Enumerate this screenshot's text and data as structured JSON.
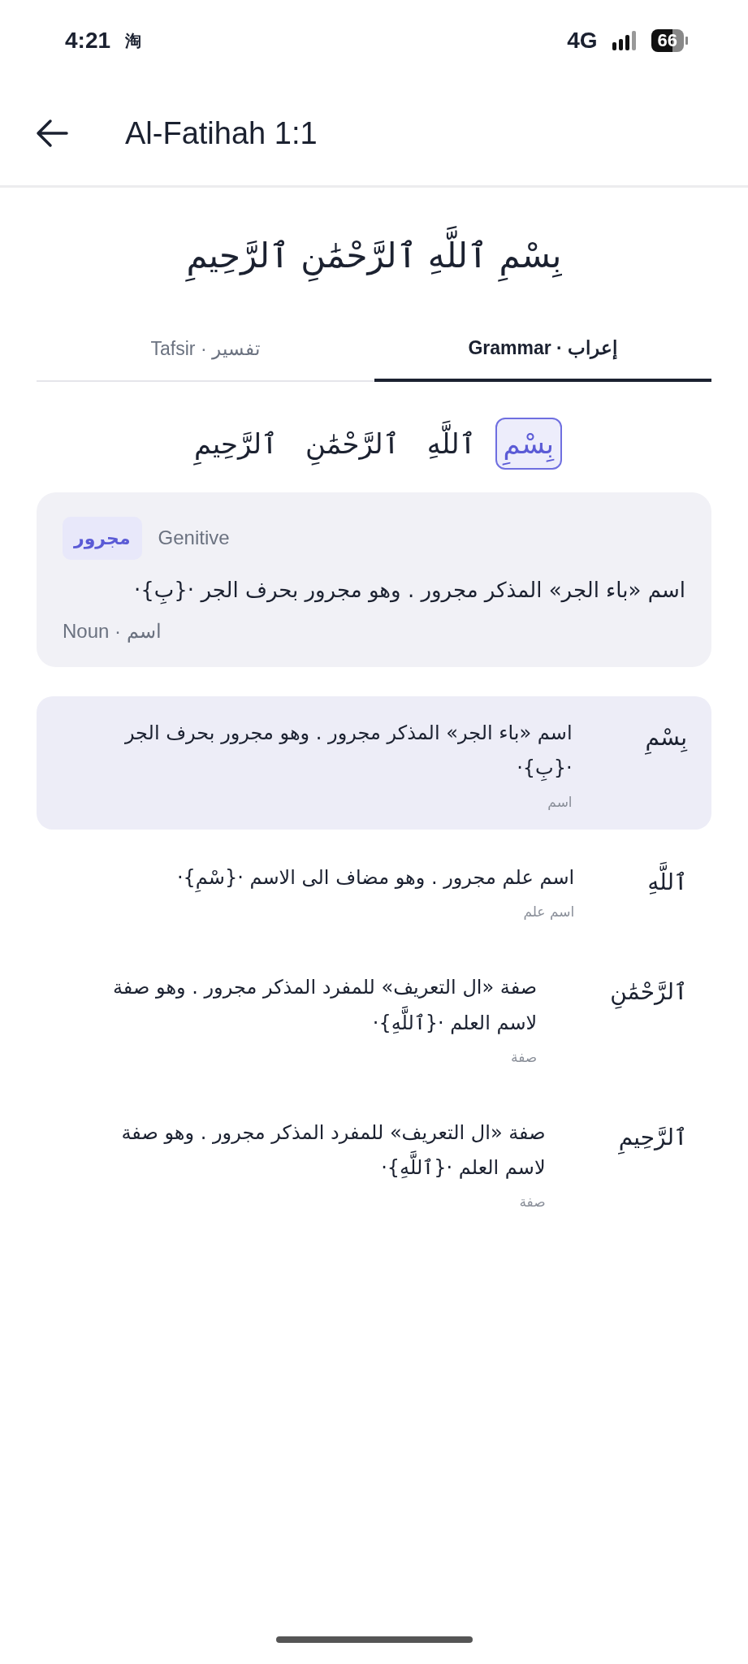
{
  "status_bar": {
    "time": "4:21",
    "notification": "淘",
    "network": "4G",
    "battery": "66"
  },
  "header": {
    "title": "Al-Fatihah 1:1"
  },
  "verse": "بِسْمِ ٱللَّهِ ٱلرَّحْمَٰنِ ٱلرَّحِيمِ",
  "tabs": [
    {
      "label": "Grammar · إعراب",
      "selected": true
    },
    {
      "label": "Tafsir · تفسير",
      "selected": false
    }
  ],
  "words": [
    {
      "text": "بِسْمِ",
      "selected": true
    },
    {
      "text": "ٱللَّهِ",
      "selected": false
    },
    {
      "text": "ٱلرَّحْمَٰنِ",
      "selected": false
    },
    {
      "text": "ٱلرَّحِيمِ",
      "selected": false
    }
  ],
  "detail": {
    "case_badge": "مجرور",
    "case_label": "Genitive",
    "description": "اسم «باء الجر» المذكر مجرور . وهو مجرور بحرف الجر ·{بِ}·",
    "part_of_speech": "Noun · اسم"
  },
  "rows": [
    {
      "word": "بِسْمِ",
      "description": "اسم «باء الجر» المذكر مجرور . وهو مجرور بحرف الجر ·{بِ}·",
      "type": "اسم",
      "selected": true
    },
    {
      "word": "ٱللَّهِ",
      "description": "اسم علم مجرور . وهو مضاف الى الاسم ·{سْمِ}·",
      "type": "اسم علم",
      "selected": false
    },
    {
      "word": "ٱلرَّحْمَٰنِ",
      "description": "صفة «ال التعريف» للمفرد المذكر مجرور . وهو صفة لاسم العلم ·{ٱللَّهِ}·",
      "type": "صفة",
      "selected": false
    },
    {
      "word": "ٱلرَّحِيمِ",
      "description": "صفة «ال التعريف» للمفرد المذكر مجرور . وهو صفة لاسم العلم ·{ٱللَّهِ}·",
      "type": "صفة",
      "selected": false
    }
  ]
}
